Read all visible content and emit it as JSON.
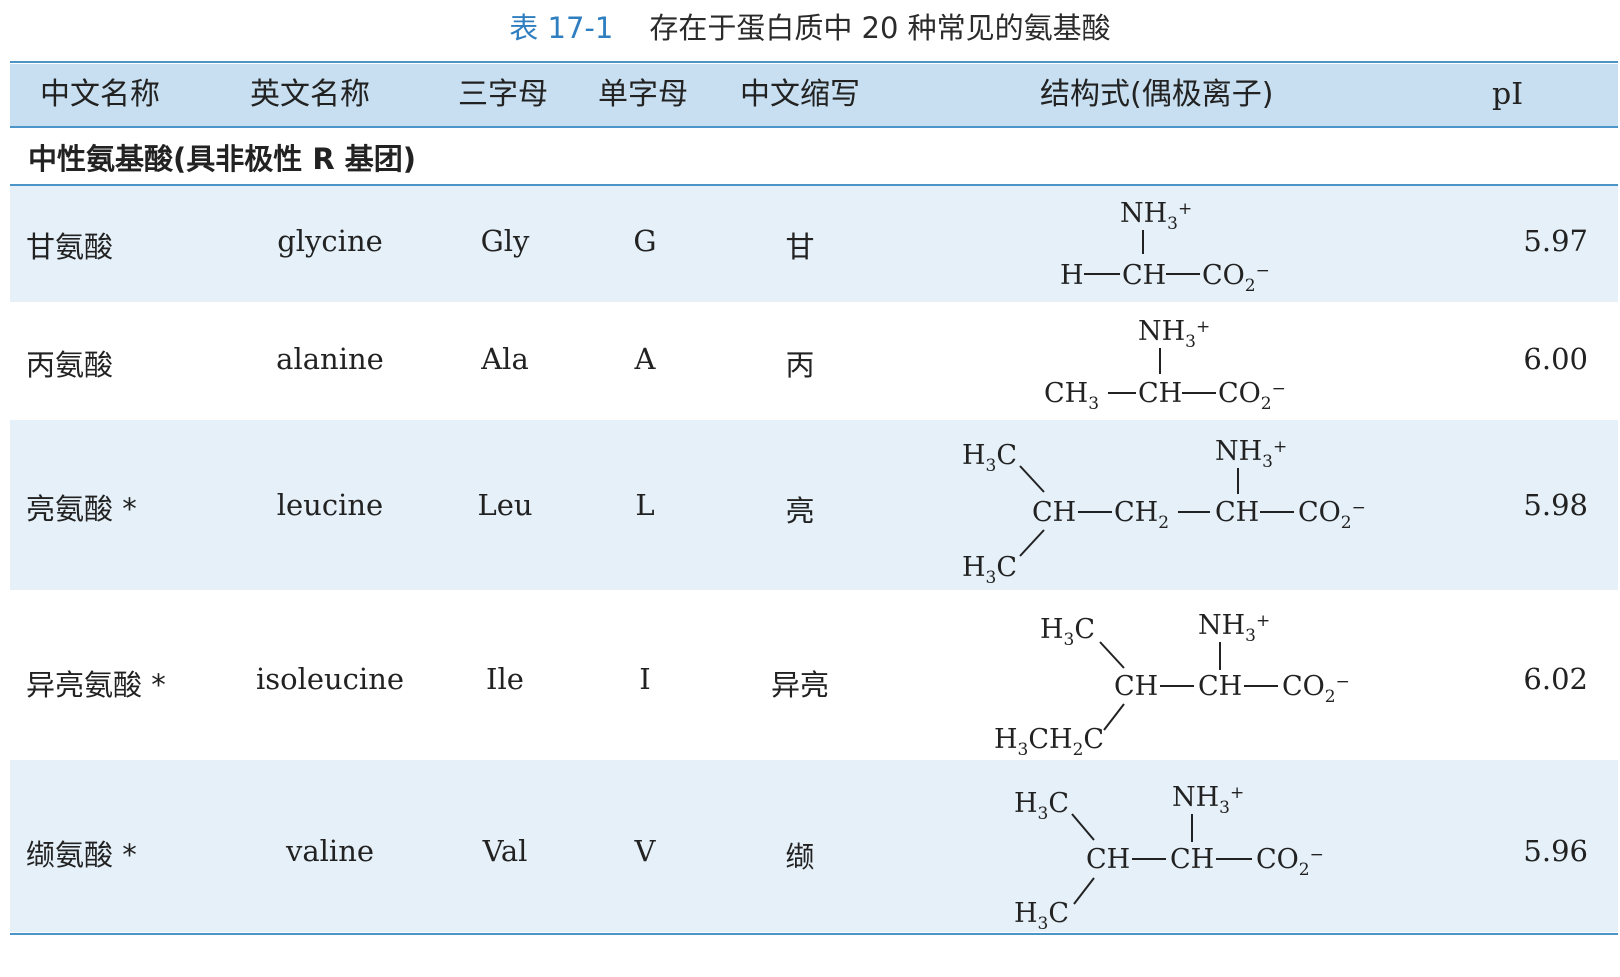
{
  "caption": {
    "number": "表 17-1",
    "title": "存在于蛋白质中 20 种常见的氨基酸"
  },
  "headers": {
    "cn_name": "中文名称",
    "en_name": "英文名称",
    "three_letter": "三字母",
    "one_letter": "单字母",
    "cn_abbr": "中文缩写",
    "structure": "结构式(偶极离子)",
    "pi": "pI"
  },
  "section_title": "中性氨基酸(具非极性 R 基团)",
  "rows": [
    {
      "cn": "甘氨酸",
      "en": "glycine",
      "three": "Gly",
      "one": "G",
      "abbr": "甘",
      "pi": "5.97",
      "s": {
        "nh3": "NH",
        "h": "H",
        "ch": "CH",
        "co2": "CO"
      }
    },
    {
      "cn": "丙氨酸",
      "en": "alanine",
      "three": "Ala",
      "one": "A",
      "abbr": "丙",
      "pi": "6.00",
      "s": {
        "nh3": "NH",
        "ch3": "CH",
        "ch": "CH",
        "co2": "CO"
      }
    },
    {
      "cn": "亮氨酸 *",
      "en": "leucine",
      "three": "Leu",
      "one": "L",
      "abbr": "亮",
      "pi": "5.98",
      "s": {
        "h3c_top": "H",
        "h3c_bot": "H",
        "ch_a": "CH",
        "ch2": "CH",
        "ch_b": "CH",
        "nh3": "NH",
        "co2": "CO"
      }
    },
    {
      "cn": "异亮氨酸 *",
      "en": "isoleucine",
      "three": "Ile",
      "one": "I",
      "abbr": "异亮",
      "pi": "6.02",
      "s": {
        "h3c_top": "H",
        "h3cch2": "H",
        "ch_a": "CH",
        "ch_b": "CH",
        "nh3": "NH",
        "co2": "CO"
      }
    },
    {
      "cn": "缬氨酸 *",
      "en": "valine",
      "three": "Val",
      "one": "V",
      "abbr": "缬",
      "pi": "5.96",
      "s": {
        "h3c_top": "H",
        "h3c_bot": "H",
        "ch_a": "CH",
        "ch_b": "CH",
        "nh3": "NH",
        "co2": "CO"
      }
    }
  ]
}
